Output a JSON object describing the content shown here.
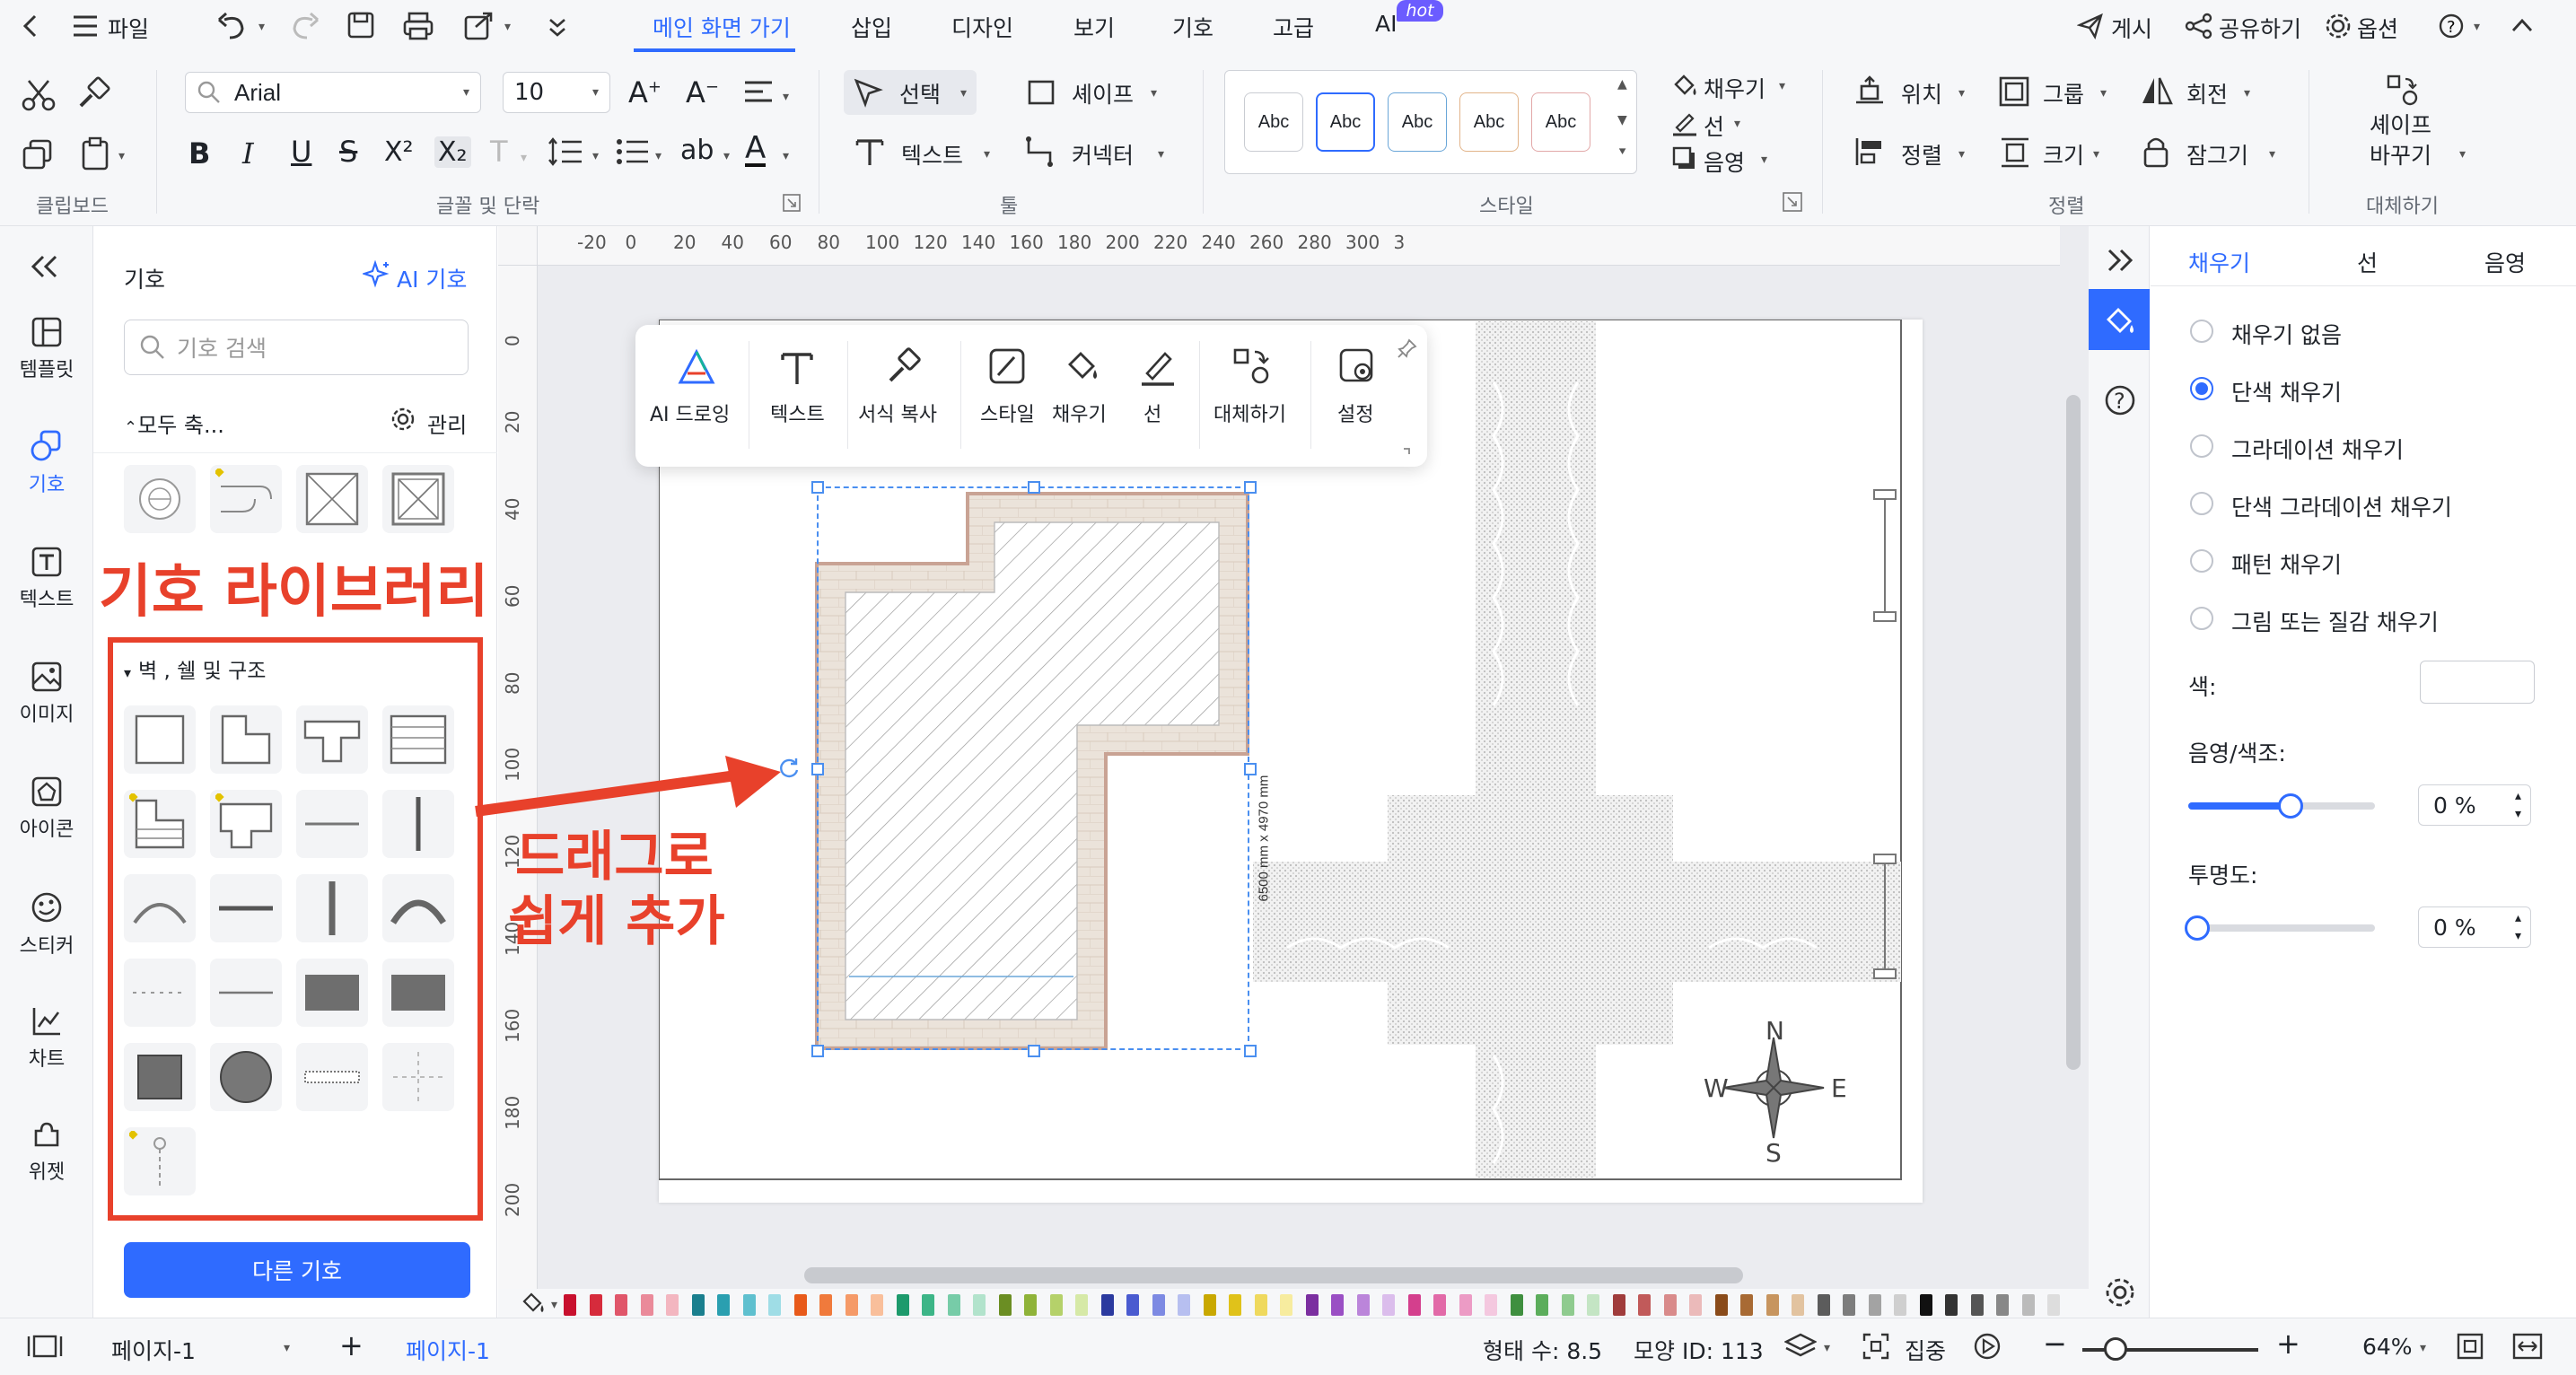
{
  "menubar": {
    "file": "파일",
    "tabs": [
      "메인 화면 가기",
      "삽입",
      "디자인",
      "보기",
      "기호",
      "고급",
      "AI"
    ],
    "hot_badge": "hot",
    "right": {
      "publish": "게시",
      "share": "공유하기",
      "options": "옵션"
    }
  },
  "ribbon": {
    "font_search_placeholder": "",
    "font_name": "Arial",
    "font_size": "10",
    "select_label": "선택",
    "shape_label": "셰이프",
    "text_label": "텍스트",
    "connector_label": "커넥터",
    "style_boxes": [
      "Abc",
      "Abc",
      "Abc",
      "Abc",
      "Abc"
    ],
    "fill_label": "채우기",
    "line_label": "선",
    "shadow_label": "음영",
    "position_label": "위치",
    "group_label": "그룹",
    "rotate_label": "회전",
    "align_label": "정렬",
    "size_label": "크기",
    "lock_label": "잠그기",
    "replace_shape_line1": "셰이프",
    "replace_shape_line2": "바꾸기",
    "groups": {
      "clipboard": "클립보드",
      "font_para": "글꼴 및 단락",
      "tools": "툴",
      "style": "스타일",
      "arrange": "정렬",
      "replace": "대체하기"
    },
    "format_glyphs": {
      "bold": "B",
      "italic": "I",
      "underline": "U",
      "strike": "S",
      "superscript": "X²",
      "subscript": "X₂",
      "text_case": "T",
      "line_spacing": "",
      "list": "",
      "ab": "ab",
      "font_color": "A"
    }
  },
  "leftrail": {
    "items": [
      {
        "label": "템플릿",
        "icon": "template-icon"
      },
      {
        "label": "기호",
        "icon": "symbol-icon"
      },
      {
        "label": "텍스트",
        "icon": "text-icon"
      },
      {
        "label": "이미지",
        "icon": "image-icon"
      },
      {
        "label": "아이콘",
        "icon": "icon-icon"
      },
      {
        "label": "스티커",
        "icon": "sticker-icon"
      },
      {
        "label": "차트",
        "icon": "chart-icon"
      },
      {
        "label": "위젯",
        "icon": "widget-icon"
      }
    ]
  },
  "sympanel": {
    "title": "기호",
    "ai_symbol": "AI 기호",
    "search_placeholder": "기호 검색",
    "collapse_all": "모두 축...",
    "manage": "관리",
    "section_title": "벽 , 쉘 및 구조",
    "more_symbols": "다른 기호"
  },
  "annotations": {
    "library": "기호 라이브러리",
    "drag_line1": "드래그로",
    "drag_line2": "쉽게 추가"
  },
  "floatbar": {
    "items": [
      "AI 드로잉",
      "텍스트",
      "서식 복사",
      "스타일",
      "채우기",
      "선",
      "대체하기",
      "설정"
    ]
  },
  "canvas": {
    "dimension_label": "6500 mm x 4970 mm",
    "compass": {
      "n": "N",
      "s": "S",
      "e": "E",
      "w": "W"
    },
    "hruler_ticks": [
      "-20",
      "0",
      "20",
      "40",
      "60",
      "80",
      "100",
      "120",
      "140",
      "160",
      "180",
      "200",
      "220",
      "240",
      "260",
      "280",
      "300",
      "3"
    ],
    "vruler_ticks": [
      "0",
      "20",
      "40",
      "60",
      "80",
      "100",
      "120",
      "140",
      "160",
      "180",
      "200"
    ]
  },
  "rightpanel": {
    "tabs": [
      "채우기",
      "선",
      "음영"
    ],
    "fill_options": [
      "채우기 없음",
      "단색 채우기",
      "그라데이션 채우기",
      "단색 그라데이션 채우기",
      "패턴 채우기",
      "그림 또는 질감 채우기"
    ],
    "selected_fill": "단색 채우기",
    "color_label": "색:",
    "shade_label": "음영/색조:",
    "shade_value": "0 %",
    "shade_level": 0.5,
    "transparency_label": "투명도:",
    "transparency_value": "0 %",
    "transparency_level": 0
  },
  "statusbar": {
    "page_selector": "페이지-1",
    "active_page": "페이지-1",
    "shape_count": "형태 수: 8.5",
    "shape_id": "모양 ID: 113",
    "focus": "집중",
    "zoom": "64%"
  },
  "palette": [
    "#c8102e",
    "#d62b3c",
    "#e0566a",
    "#ea8a9a",
    "#f3b6c0",
    "#1a7f8e",
    "#2a9fb0",
    "#5fc0cf",
    "#9fdde6",
    "#e85a1a",
    "#f07a3c",
    "#f59a68",
    "#f9bf9b",
    "#1d9a6c",
    "#3cb587",
    "#77cca8",
    "#b2e3cc",
    "#6b8e23",
    "#8fb339",
    "#b5d16a",
    "#d6e9a7",
    "#2b3a9f",
    "#4a5bd0",
    "#7d8ae3",
    "#b7bff0",
    "#c9a800",
    "#e0c21a",
    "#efd95e",
    "#f7ec9f",
    "#7b2fa0",
    "#9a4fc4",
    "#bb85da",
    "#dbbdec",
    "#d43f8d",
    "#e26aa8",
    "#ec9bc5",
    "#f4c8df",
    "#3f8f3f",
    "#5cad5c",
    "#8fcb8f",
    "#c4e5c4",
    "#a03c3c",
    "#c15a5a",
    "#d98b8b",
    "#ebbaba",
    "#8a4b1a",
    "#a86a34",
    "#c7955f",
    "#e2c3a0",
    "#5c5c5c",
    "#7d7d7d",
    "#a3a3a3",
    "#cfcfcf",
    "#111111",
    "#333333",
    "#555555",
    "#888888",
    "#bbbbbb",
    "#dddddd"
  ]
}
